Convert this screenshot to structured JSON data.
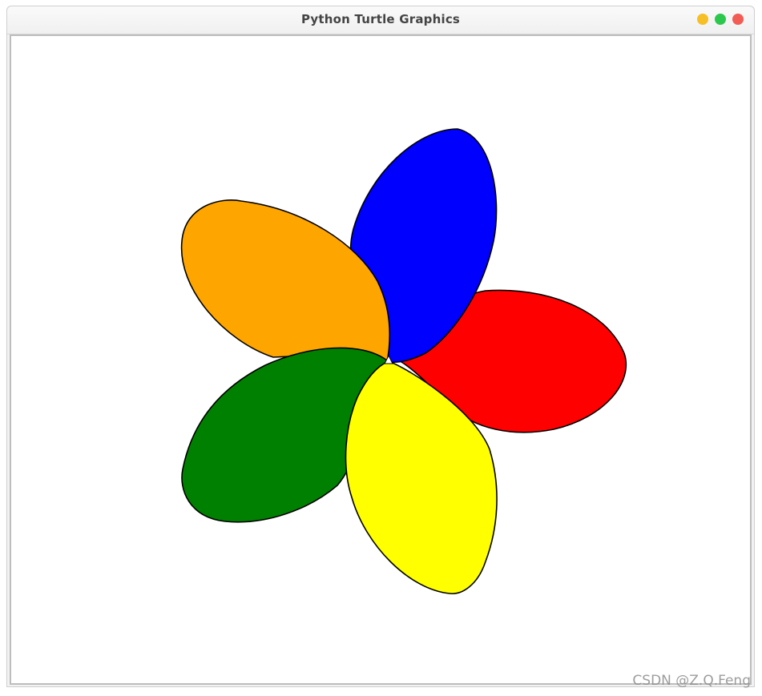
{
  "window": {
    "title": "Python Turtle Graphics",
    "buttons": [
      {
        "name": "minimize",
        "color": "#f6bf26"
      },
      {
        "name": "maximize",
        "color": "#2cc84d"
      },
      {
        "name": "close",
        "color": "#f25c54"
      }
    ]
  },
  "drawing": {
    "background": "#ffffff",
    "outline_color": "#000000",
    "petals": [
      {
        "name": "petal-red",
        "color": "#ff0000"
      },
      {
        "name": "petal-blue",
        "color": "#0000ff"
      },
      {
        "name": "petal-orange",
        "color": "#ffa500"
      },
      {
        "name": "petal-green",
        "color": "#008000"
      },
      {
        "name": "petal-yellow",
        "color": "#ffff00"
      }
    ],
    "turtle_cursor": "arrow-icon"
  },
  "watermark": "CSDN @Z.Q.Feng"
}
